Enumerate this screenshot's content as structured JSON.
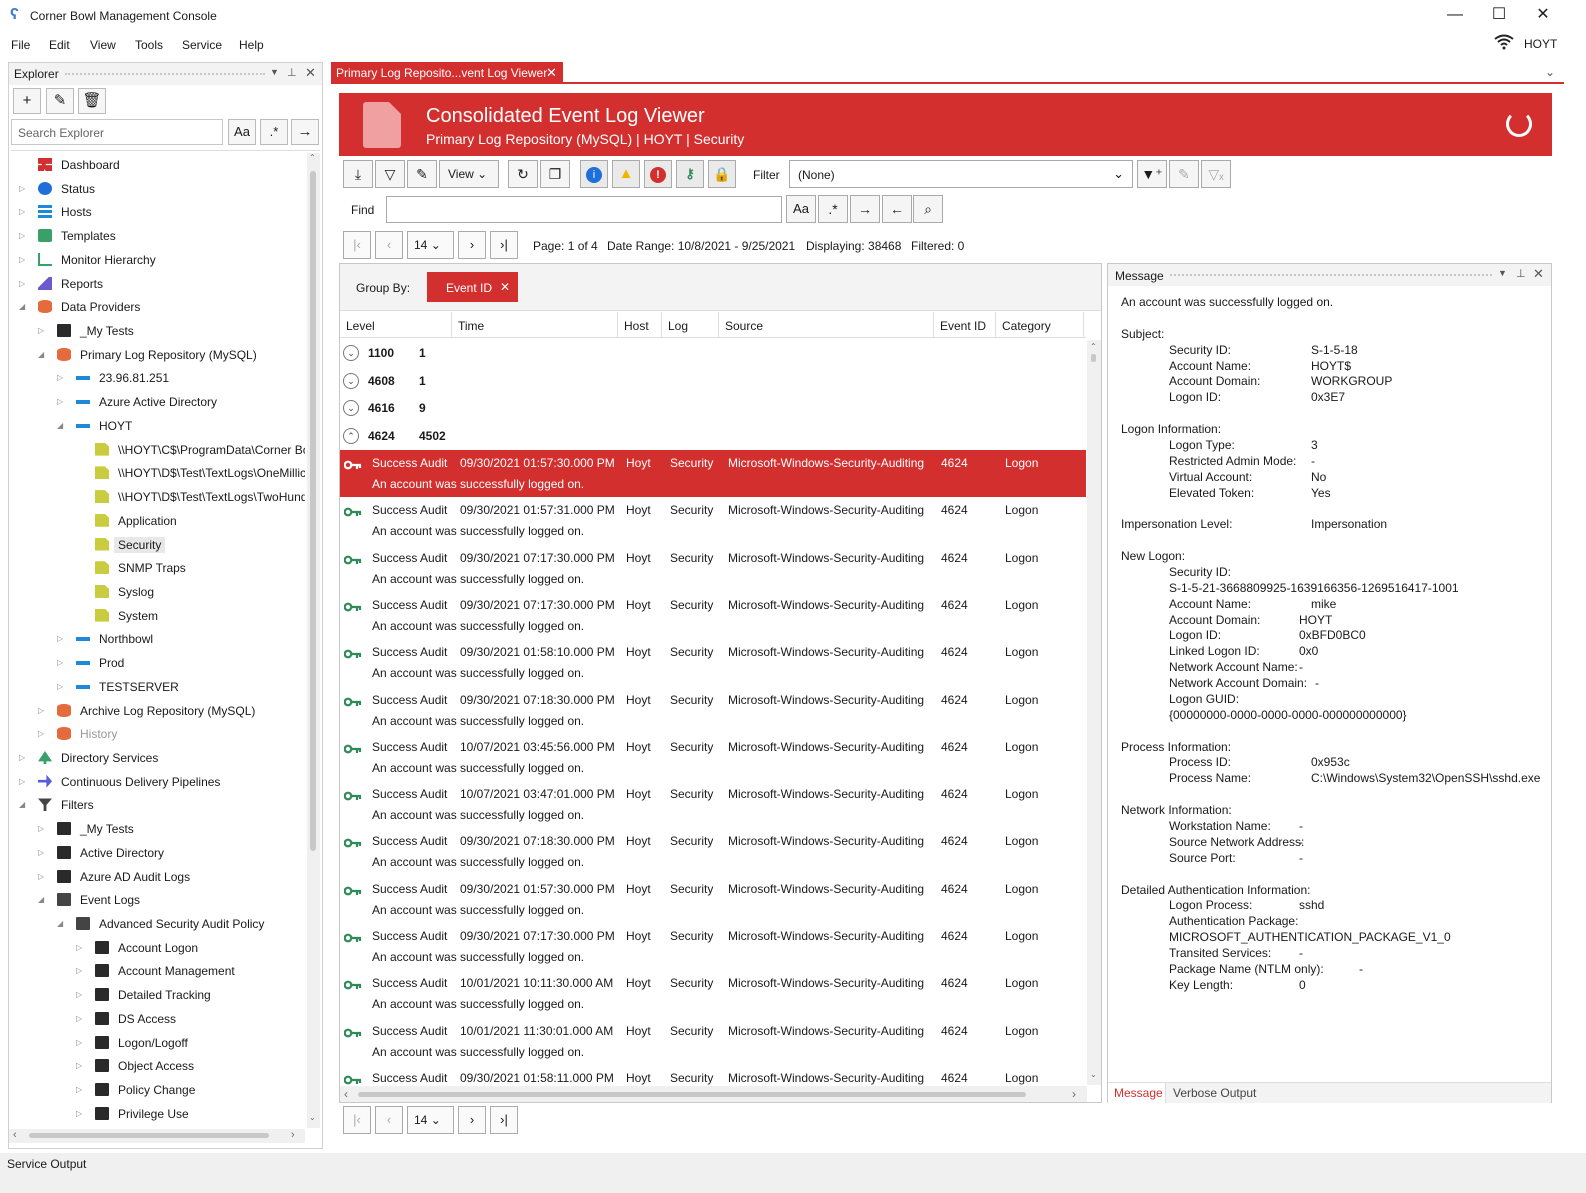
{
  "window": {
    "title": "Corner Bowl Management Console",
    "minimize": "—",
    "maximize": "☐",
    "close": "✕"
  },
  "menu": [
    "File",
    "Edit",
    "View",
    "Tools",
    "Service",
    "Help"
  ],
  "user": "HOYT",
  "explorer": {
    "title": "Explorer",
    "search_placeholder": "Search Explorer",
    "case_btn": "Aa",
    "regex_btn": ".*",
    "go_btn": "→",
    "tree": [
      {
        "label": "Dashboard",
        "indent": 0,
        "exp": "",
        "icon": "dashboard-icon"
      },
      {
        "label": "Status",
        "indent": 0,
        "exp": "▷",
        "icon": "info-icon"
      },
      {
        "label": "Hosts",
        "indent": 0,
        "exp": "▷",
        "icon": "hosts-icon"
      },
      {
        "label": "Templates",
        "indent": 0,
        "exp": "▷",
        "icon": "template-icon"
      },
      {
        "label": "Monitor Hierarchy",
        "indent": 0,
        "exp": "▷",
        "icon": "hierarchy-icon"
      },
      {
        "label": "Reports",
        "indent": 0,
        "exp": "▷",
        "icon": "reports-icon"
      },
      {
        "label": "Data Providers",
        "indent": 0,
        "exp": "◢",
        "icon": "database-icon"
      },
      {
        "label": "_My Tests",
        "indent": 1,
        "exp": "▷",
        "icon": "folder-icon"
      },
      {
        "label": "Primary Log Repository (MySQL)",
        "indent": 1,
        "exp": "◢",
        "icon": "database-icon"
      },
      {
        "label": "23.96.81.251",
        "indent": 2,
        "exp": "▷",
        "icon": "host-icon"
      },
      {
        "label": "Azure Active Directory",
        "indent": 2,
        "exp": "▷",
        "icon": "host-icon"
      },
      {
        "label": "HOYT",
        "indent": 2,
        "exp": "◢",
        "icon": "host-icon"
      },
      {
        "label": "\\\\HOYT\\C$\\ProgramData\\Corner Bc",
        "indent": 3,
        "exp": "",
        "icon": "log-icon"
      },
      {
        "label": "\\\\HOYT\\D$\\Test\\TextLogs\\OneMillic",
        "indent": 3,
        "exp": "",
        "icon": "log-icon"
      },
      {
        "label": "\\\\HOYT\\D$\\Test\\TextLogs\\TwoHund",
        "indent": 3,
        "exp": "",
        "icon": "log-icon"
      },
      {
        "label": "Application",
        "indent": 3,
        "exp": "",
        "icon": "log-icon"
      },
      {
        "label": "Security",
        "indent": 3,
        "exp": "",
        "icon": "log-icon",
        "selected": true
      },
      {
        "label": "SNMP Traps",
        "indent": 3,
        "exp": "",
        "icon": "log-icon"
      },
      {
        "label": "Syslog",
        "indent": 3,
        "exp": "",
        "icon": "log-icon"
      },
      {
        "label": "System",
        "indent": 3,
        "exp": "",
        "icon": "log-icon"
      },
      {
        "label": "Northbowl",
        "indent": 2,
        "exp": "▷",
        "icon": "host-icon"
      },
      {
        "label": "Prod",
        "indent": 2,
        "exp": "▷",
        "icon": "host-icon"
      },
      {
        "label": "TESTSERVER",
        "indent": 2,
        "exp": "▷",
        "icon": "host-icon"
      },
      {
        "label": "Archive Log Repository (MySQL)",
        "indent": 1,
        "exp": "▷",
        "icon": "database-icon"
      },
      {
        "label": "History",
        "indent": 1,
        "exp": "▷",
        "icon": "database-icon",
        "muted": true
      },
      {
        "label": "Directory Services",
        "indent": 0,
        "exp": "▷",
        "icon": "tree-icon"
      },
      {
        "label": "Continuous Delivery Pipelines",
        "indent": 0,
        "exp": "▷",
        "icon": "pipeline-icon"
      },
      {
        "label": "Filters",
        "indent": 0,
        "exp": "◢",
        "icon": "filter-icon"
      },
      {
        "label": "_My Tests",
        "indent": 1,
        "exp": "▷",
        "icon": "folder-icon"
      },
      {
        "label": "Active Directory",
        "indent": 1,
        "exp": "▷",
        "icon": "folder-icon"
      },
      {
        "label": "Azure AD Audit Logs",
        "indent": 1,
        "exp": "▷",
        "icon": "folder-icon"
      },
      {
        "label": "Event Logs",
        "indent": 1,
        "exp": "◢",
        "icon": "folder-open-icon"
      },
      {
        "label": "Advanced Security Audit Policy",
        "indent": 2,
        "exp": "◢",
        "icon": "folder-open-icon"
      },
      {
        "label": "Account Logon",
        "indent": 3,
        "exp": "▷",
        "icon": "folder-icon"
      },
      {
        "label": "Account Management",
        "indent": 3,
        "exp": "▷",
        "icon": "folder-icon"
      },
      {
        "label": "Detailed Tracking",
        "indent": 3,
        "exp": "▷",
        "icon": "folder-icon"
      },
      {
        "label": "DS Access",
        "indent": 3,
        "exp": "▷",
        "icon": "folder-icon"
      },
      {
        "label": "Logon/Logoff",
        "indent": 3,
        "exp": "▷",
        "icon": "folder-icon"
      },
      {
        "label": "Object Access",
        "indent": 3,
        "exp": "▷",
        "icon": "folder-icon"
      },
      {
        "label": "Policy Change",
        "indent": 3,
        "exp": "▷",
        "icon": "folder-icon"
      },
      {
        "label": "Privilege Use",
        "indent": 3,
        "exp": "▷",
        "icon": "folder-icon"
      }
    ]
  },
  "tab": {
    "label": "Primary Log Reposito...vent Log Viewer",
    "close": "✕"
  },
  "banner": {
    "title": "Consolidated Event Log Viewer",
    "subtitle": "Primary Log Repository (MySQL) | HOYT | Security"
  },
  "toolbar": {
    "view_label": "View",
    "filter_label": "Filter",
    "filter_value": "(None)",
    "find_label": "Find"
  },
  "pager": {
    "page_size": "14",
    "page_info": "Page: 1 of 4",
    "date_range": "Date Range: 10/8/2021 - 9/25/2021",
    "displaying": "Displaying: 38468",
    "filtered": "Filtered: 0"
  },
  "groupby": {
    "label": "Group By:",
    "chip": "Event ID",
    "chip_close": "✕"
  },
  "columns": [
    "Level",
    "Time",
    "Host",
    "Log",
    "Source",
    "Event ID",
    "Category"
  ],
  "groups": [
    {
      "id": "1100",
      "count": "1",
      "expanded": false
    },
    {
      "id": "4608",
      "count": "1",
      "expanded": false
    },
    {
      "id": "4616",
      "count": "9",
      "expanded": false
    },
    {
      "id": "4624",
      "count": "4502",
      "expanded": true
    }
  ],
  "events": [
    {
      "level": "Success Audit",
      "time": "09/30/2021 01:57:30.000 PM",
      "host": "Hoyt",
      "log": "Security",
      "source": "Microsoft-Windows-Security-Auditing",
      "event_id": "4624",
      "category": "Logon",
      "message": "An account was successfully logged on.",
      "selected": true
    },
    {
      "level": "Success Audit",
      "time": "09/30/2021 01:57:31.000 PM",
      "host": "Hoyt",
      "log": "Security",
      "source": "Microsoft-Windows-Security-Auditing",
      "event_id": "4624",
      "category": "Logon",
      "message": "An account was successfully logged on."
    },
    {
      "level": "Success Audit",
      "time": "09/30/2021 07:17:30.000 PM",
      "host": "Hoyt",
      "log": "Security",
      "source": "Microsoft-Windows-Security-Auditing",
      "event_id": "4624",
      "category": "Logon",
      "message": "An account was successfully logged on."
    },
    {
      "level": "Success Audit",
      "time": "09/30/2021 07:17:30.000 PM",
      "host": "Hoyt",
      "log": "Security",
      "source": "Microsoft-Windows-Security-Auditing",
      "event_id": "4624",
      "category": "Logon",
      "message": "An account was successfully logged on."
    },
    {
      "level": "Success Audit",
      "time": "09/30/2021 01:58:10.000 PM",
      "host": "Hoyt",
      "log": "Security",
      "source": "Microsoft-Windows-Security-Auditing",
      "event_id": "4624",
      "category": "Logon",
      "message": "An account was successfully logged on."
    },
    {
      "level": "Success Audit",
      "time": "09/30/2021 07:18:30.000 PM",
      "host": "Hoyt",
      "log": "Security",
      "source": "Microsoft-Windows-Security-Auditing",
      "event_id": "4624",
      "category": "Logon",
      "message": "An account was successfully logged on."
    },
    {
      "level": "Success Audit",
      "time": "10/07/2021 03:45:56.000 PM",
      "host": "Hoyt",
      "log": "Security",
      "source": "Microsoft-Windows-Security-Auditing",
      "event_id": "4624",
      "category": "Logon",
      "message": "An account was successfully logged on."
    },
    {
      "level": "Success Audit",
      "time": "10/07/2021 03:47:01.000 PM",
      "host": "Hoyt",
      "log": "Security",
      "source": "Microsoft-Windows-Security-Auditing",
      "event_id": "4624",
      "category": "Logon",
      "message": "An account was successfully logged on."
    },
    {
      "level": "Success Audit",
      "time": "09/30/2021 07:18:30.000 PM",
      "host": "Hoyt",
      "log": "Security",
      "source": "Microsoft-Windows-Security-Auditing",
      "event_id": "4624",
      "category": "Logon",
      "message": "An account was successfully logged on."
    },
    {
      "level": "Success Audit",
      "time": "09/30/2021 01:57:30.000 PM",
      "host": "Hoyt",
      "log": "Security",
      "source": "Microsoft-Windows-Security-Auditing",
      "event_id": "4624",
      "category": "Logon",
      "message": "An account was successfully logged on."
    },
    {
      "level": "Success Audit",
      "time": "09/30/2021 07:17:30.000 PM",
      "host": "Hoyt",
      "log": "Security",
      "source": "Microsoft-Windows-Security-Auditing",
      "event_id": "4624",
      "category": "Logon",
      "message": "An account was successfully logged on."
    },
    {
      "level": "Success Audit",
      "time": "10/01/2021 10:11:30.000 AM",
      "host": "Hoyt",
      "log": "Security",
      "source": "Microsoft-Windows-Security-Auditing",
      "event_id": "4624",
      "category": "Logon",
      "message": "An account was successfully logged on."
    },
    {
      "level": "Success Audit",
      "time": "10/01/2021 11:30:01.000 AM",
      "host": "Hoyt",
      "log": "Security",
      "source": "Microsoft-Windows-Security-Auditing",
      "event_id": "4624",
      "category": "Logon",
      "message": "An account was successfully logged on."
    },
    {
      "level": "Success Audit",
      "time": "09/30/2021 01:58:11.000 PM",
      "host": "Hoyt",
      "log": "Security",
      "source": "Microsoft-Windows-Security-Auditing",
      "event_id": "4624",
      "category": "Logon",
      "message": ""
    }
  ],
  "message_panel": {
    "title": "Message",
    "lines": [
      {
        "t": "An account was successfully logged on.",
        "k": 0
      },
      {
        "t": "Subject:",
        "k": 0
      },
      {
        "t": "Security ID:",
        "v": "S-1-5-18",
        "k": 1
      },
      {
        "t": "Account Name:",
        "v": "HOYT$",
        "k": 1
      },
      {
        "t": "Account Domain:",
        "v": "WORKGROUP",
        "k": 1
      },
      {
        "t": "Logon ID:",
        "v": "0x3E7",
        "k": 1
      },
      {
        "t": "Logon Information:",
        "k": 0
      },
      {
        "t": "Logon Type:",
        "v": "3",
        "k": 1
      },
      {
        "t": "Restricted Admin Mode:",
        "v": "-",
        "k": 1
      },
      {
        "t": "Virtual Account:",
        "v": "No",
        "k": 1
      },
      {
        "t": "Elevated Token:",
        "v": "Yes",
        "k": 1
      },
      {
        "t": "Impersonation Level:",
        "v": "Impersonation",
        "k": 0
      },
      {
        "t": "New Logon:",
        "k": 0
      },
      {
        "t": "Security ID:",
        "k": 1
      },
      {
        "t": "S-1-5-21-3668809925-1639166356-1269516417-1001",
        "k": 1
      },
      {
        "t": "Account Name:",
        "v": "mike",
        "k": 1
      },
      {
        "t": "Account Domain:",
        "v": "HOYT",
        "k": 1
      },
      {
        "t": "Logon ID:",
        "v": "0xBFD0BC0",
        "k": 1
      },
      {
        "t": "Linked Logon ID:",
        "v": "0x0",
        "k": 1
      },
      {
        "t": "Network Account Name:",
        "v": "-",
        "k": 1
      },
      {
        "t": "Network Account Domain:",
        "v": "-",
        "k": 1
      },
      {
        "t": "Logon GUID:",
        "k": 1
      },
      {
        "t": "{00000000-0000-0000-0000-000000000000}",
        "k": 1
      },
      {
        "t": "Process Information:",
        "k": 0
      },
      {
        "t": "Process ID:",
        "v": "0x953c",
        "k": 1
      },
      {
        "t": "Process Name:",
        "v": "C:\\Windows\\System32\\OpenSSH\\sshd.exe",
        "k": 1
      },
      {
        "t": "Network Information:",
        "k": 0
      },
      {
        "t": "Workstation Name:",
        "v": "-",
        "k": 1
      },
      {
        "t": "Source Network Address:",
        "v": "-",
        "k": 1
      },
      {
        "t": "Source Port:",
        "v": "-",
        "k": 1
      },
      {
        "t": "Detailed Authentication Information:",
        "k": 0
      },
      {
        "t": "Logon Process:",
        "v": "sshd",
        "k": 1
      },
      {
        "t": "Authentication Package:",
        "k": 1
      },
      {
        "t": "MICROSOFT_AUTHENTICATION_PACKAGE_V1_0",
        "k": 1
      },
      {
        "t": "Transited Services:",
        "v": "-",
        "k": 1
      },
      {
        "t": "Package Name (NTLM only):",
        "v": "-",
        "k": 1
      },
      {
        "t": "Key Length:",
        "v": "0",
        "k": 1
      }
    ],
    "tabs": [
      "Message",
      "Verbose Output"
    ]
  },
  "status": {
    "label": "Service Output"
  },
  "colors": {
    "accent": "#d32f2f",
    "key_green": "#2e8b57"
  }
}
